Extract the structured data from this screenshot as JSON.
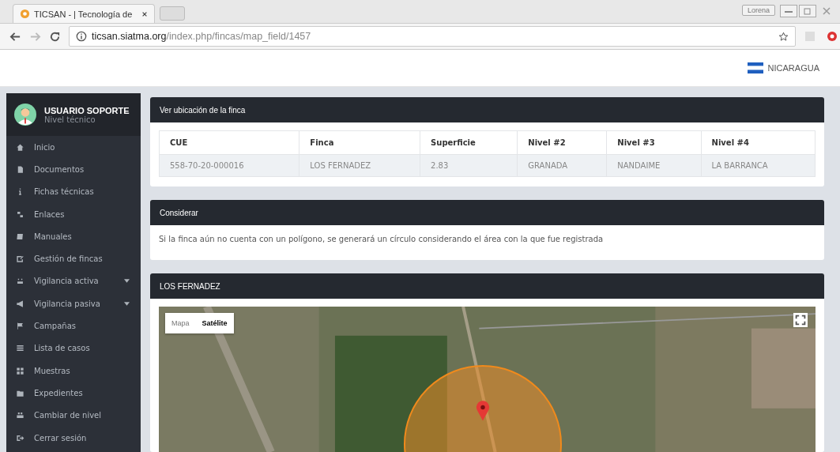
{
  "browser": {
    "tab_title": "TICSAN - | Tecnología de",
    "profile": "Lorena",
    "url_host": "ticsan.siatma.org",
    "url_path": "/index.php/fincas/map_field/1457"
  },
  "header": {
    "country": "NICARAGUA"
  },
  "sidebar": {
    "user_name": "USUARIO SOPORTE",
    "user_level": "Nivel técnico",
    "items": [
      {
        "label": "Inicio",
        "has_submenu": false
      },
      {
        "label": "Documentos",
        "has_submenu": false
      },
      {
        "label": "Fichas técnicas",
        "has_submenu": false
      },
      {
        "label": "Enlaces",
        "has_submenu": false
      },
      {
        "label": "Manuales",
        "has_submenu": false
      },
      {
        "label": "Gestión de fincas",
        "has_submenu": false
      },
      {
        "label": "Vigilancia activa",
        "has_submenu": true
      },
      {
        "label": "Vigilancia pasiva",
        "has_submenu": true
      },
      {
        "label": "Campañas",
        "has_submenu": false
      },
      {
        "label": "Lista de casos",
        "has_submenu": false
      },
      {
        "label": "Muestras",
        "has_submenu": false
      },
      {
        "label": "Expedientes",
        "has_submenu": false
      },
      {
        "label": "Cambiar de nivel",
        "has_submenu": false
      },
      {
        "label": "Cerrar sesión",
        "has_submenu": false
      }
    ]
  },
  "location_panel": {
    "title": "Ver ubicación de la finca",
    "table": {
      "columns": [
        "CUE",
        "Finca",
        "Superficie",
        "Nivel #2",
        "Nivel #3",
        "Nivel #4"
      ],
      "rows": [
        [
          "558-70-20-000016",
          "LOS FERNADEZ",
          "2.83",
          "GRANADA",
          "NANDAIME",
          "LA BARRANCA"
        ]
      ]
    }
  },
  "note_panel": {
    "title": "Considerar",
    "text": "Si la finca aún no cuenta con un polígono, se generará un círculo considerando el área con la que fue registrada"
  },
  "map_panel": {
    "title": "LOS FERNADEZ",
    "map_types": [
      {
        "label": "Mapa",
        "selected": false
      },
      {
        "label": "Satélite",
        "selected": true
      }
    ]
  }
}
